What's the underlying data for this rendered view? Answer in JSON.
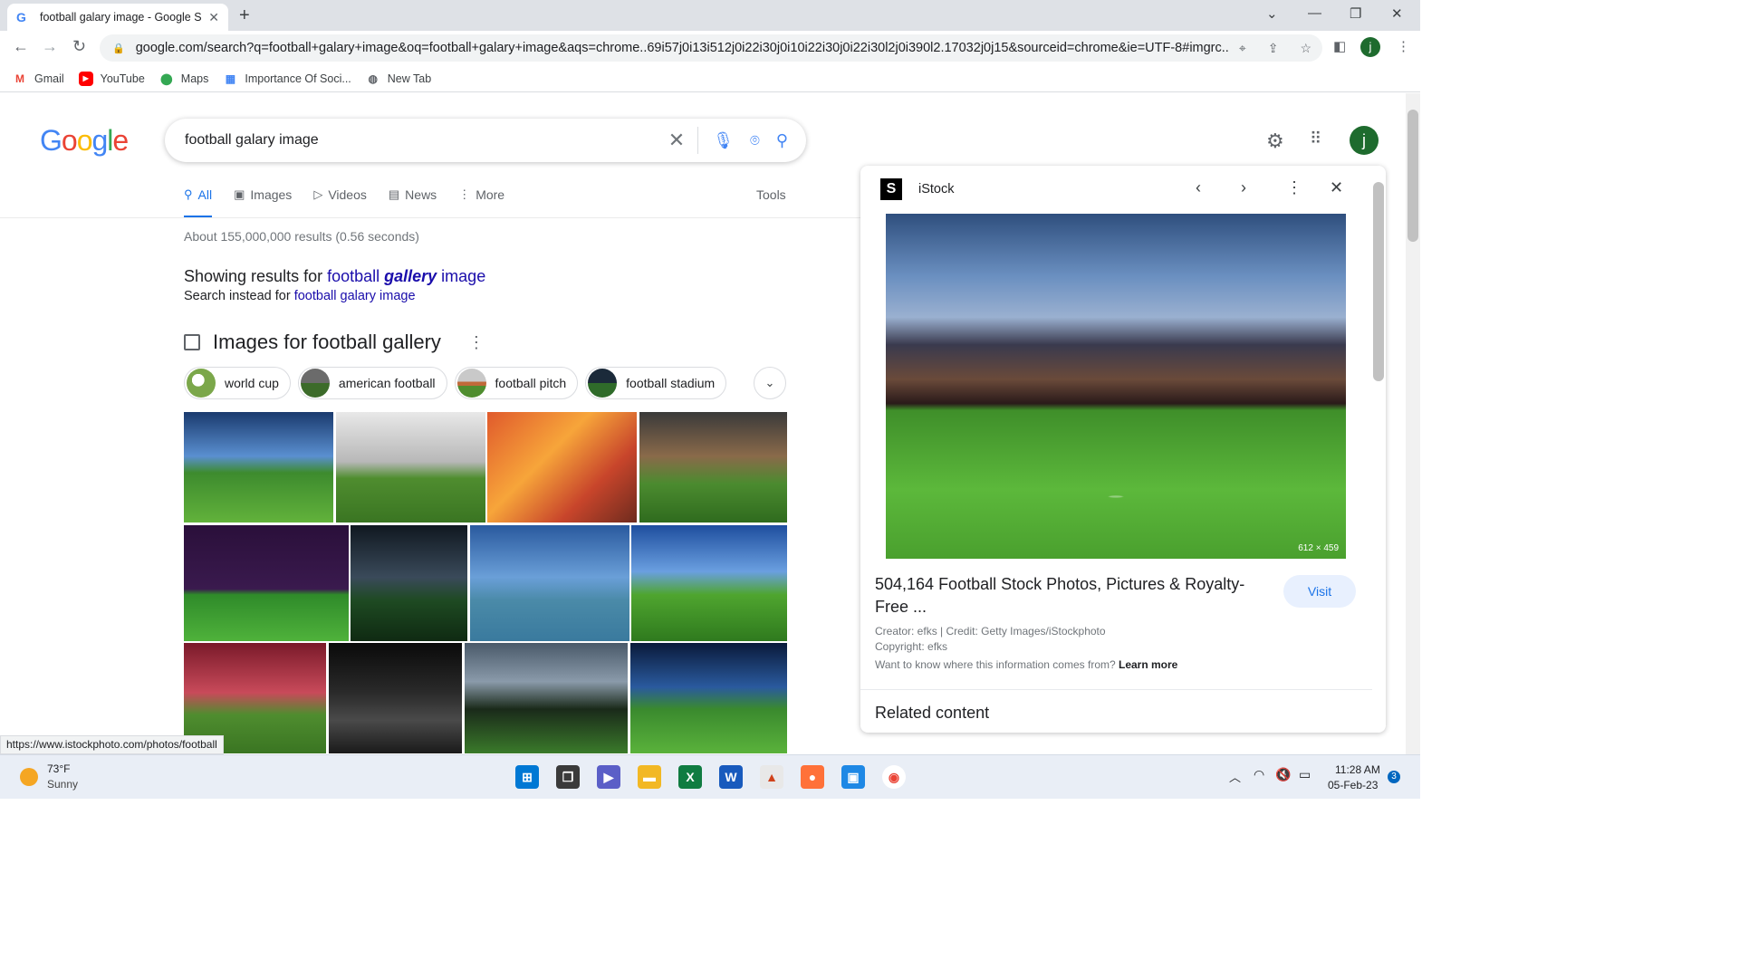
{
  "browser": {
    "tab_title": "football galary image - Google Se",
    "url": "google.com/search?q=football+galary+image&oq=football+galary+image&aqs=chrome..69i57j0i13i512j0i22i30j0i10i22i30j0i22i30l2j0i390l2.17032j0j15&sourceid=chrome&ie=UTF-8#imgrc...",
    "profile_initial": "j",
    "bookmarks": [
      {
        "label": "Gmail",
        "icon": "gmail-icon",
        "color": "#ea4335"
      },
      {
        "label": "YouTube",
        "icon": "youtube-icon",
        "color": "#ff0000"
      },
      {
        "label": "Maps",
        "icon": "maps-icon",
        "color": "#34a853"
      },
      {
        "label": "Importance Of Soci...",
        "icon": "bookmark-page-icon",
        "color": "#4285f4"
      },
      {
        "label": "New Tab",
        "icon": "globe-icon",
        "color": "#5f6368"
      }
    ]
  },
  "google": {
    "logo": "Google",
    "query": "football galary image",
    "tabs": [
      {
        "label": "All",
        "icon": "search-icon",
        "active": true
      },
      {
        "label": "Images",
        "icon": "image-icon",
        "active": false
      },
      {
        "label": "Videos",
        "icon": "video-icon",
        "active": false
      },
      {
        "label": "News",
        "icon": "news-icon",
        "active": false
      },
      {
        "label": "More",
        "icon": "more-dots-icon",
        "active": false
      }
    ],
    "tools_label": "Tools",
    "stats": "About 155,000,000 results (0.56 seconds)",
    "showing_prefix": "Showing results for ",
    "showing_word1": "football ",
    "showing_word2": "gallery",
    "showing_word3": " image",
    "instead_prefix": "Search instead for ",
    "instead_link": "football galary image",
    "images_header": "Images for football gallery",
    "chips": [
      {
        "label": "world cup"
      },
      {
        "label": "american football"
      },
      {
        "label": "football pitch"
      },
      {
        "label": "football stadium"
      }
    ],
    "user_initial": "j"
  },
  "panel": {
    "source": "iStock",
    "image_dimensions": "612 × 459",
    "title": "504,164 Football Stock Photos, Pictures & Royalty-Free ...",
    "visit_label": "Visit",
    "creator": "Creator: efks | Credit: Getty Images/iStockphoto",
    "copyright": "Copyright: efks",
    "want_to_know": "Want to know where this information comes from? ",
    "learn_more": "Learn more",
    "related": "Related content"
  },
  "status_url": "https://www.istockphoto.com/photos/football",
  "taskbar": {
    "temperature": "73°F",
    "condition": "Sunny",
    "time": "11:28 AM",
    "date": "05-Feb-23",
    "notification_count": "3"
  }
}
